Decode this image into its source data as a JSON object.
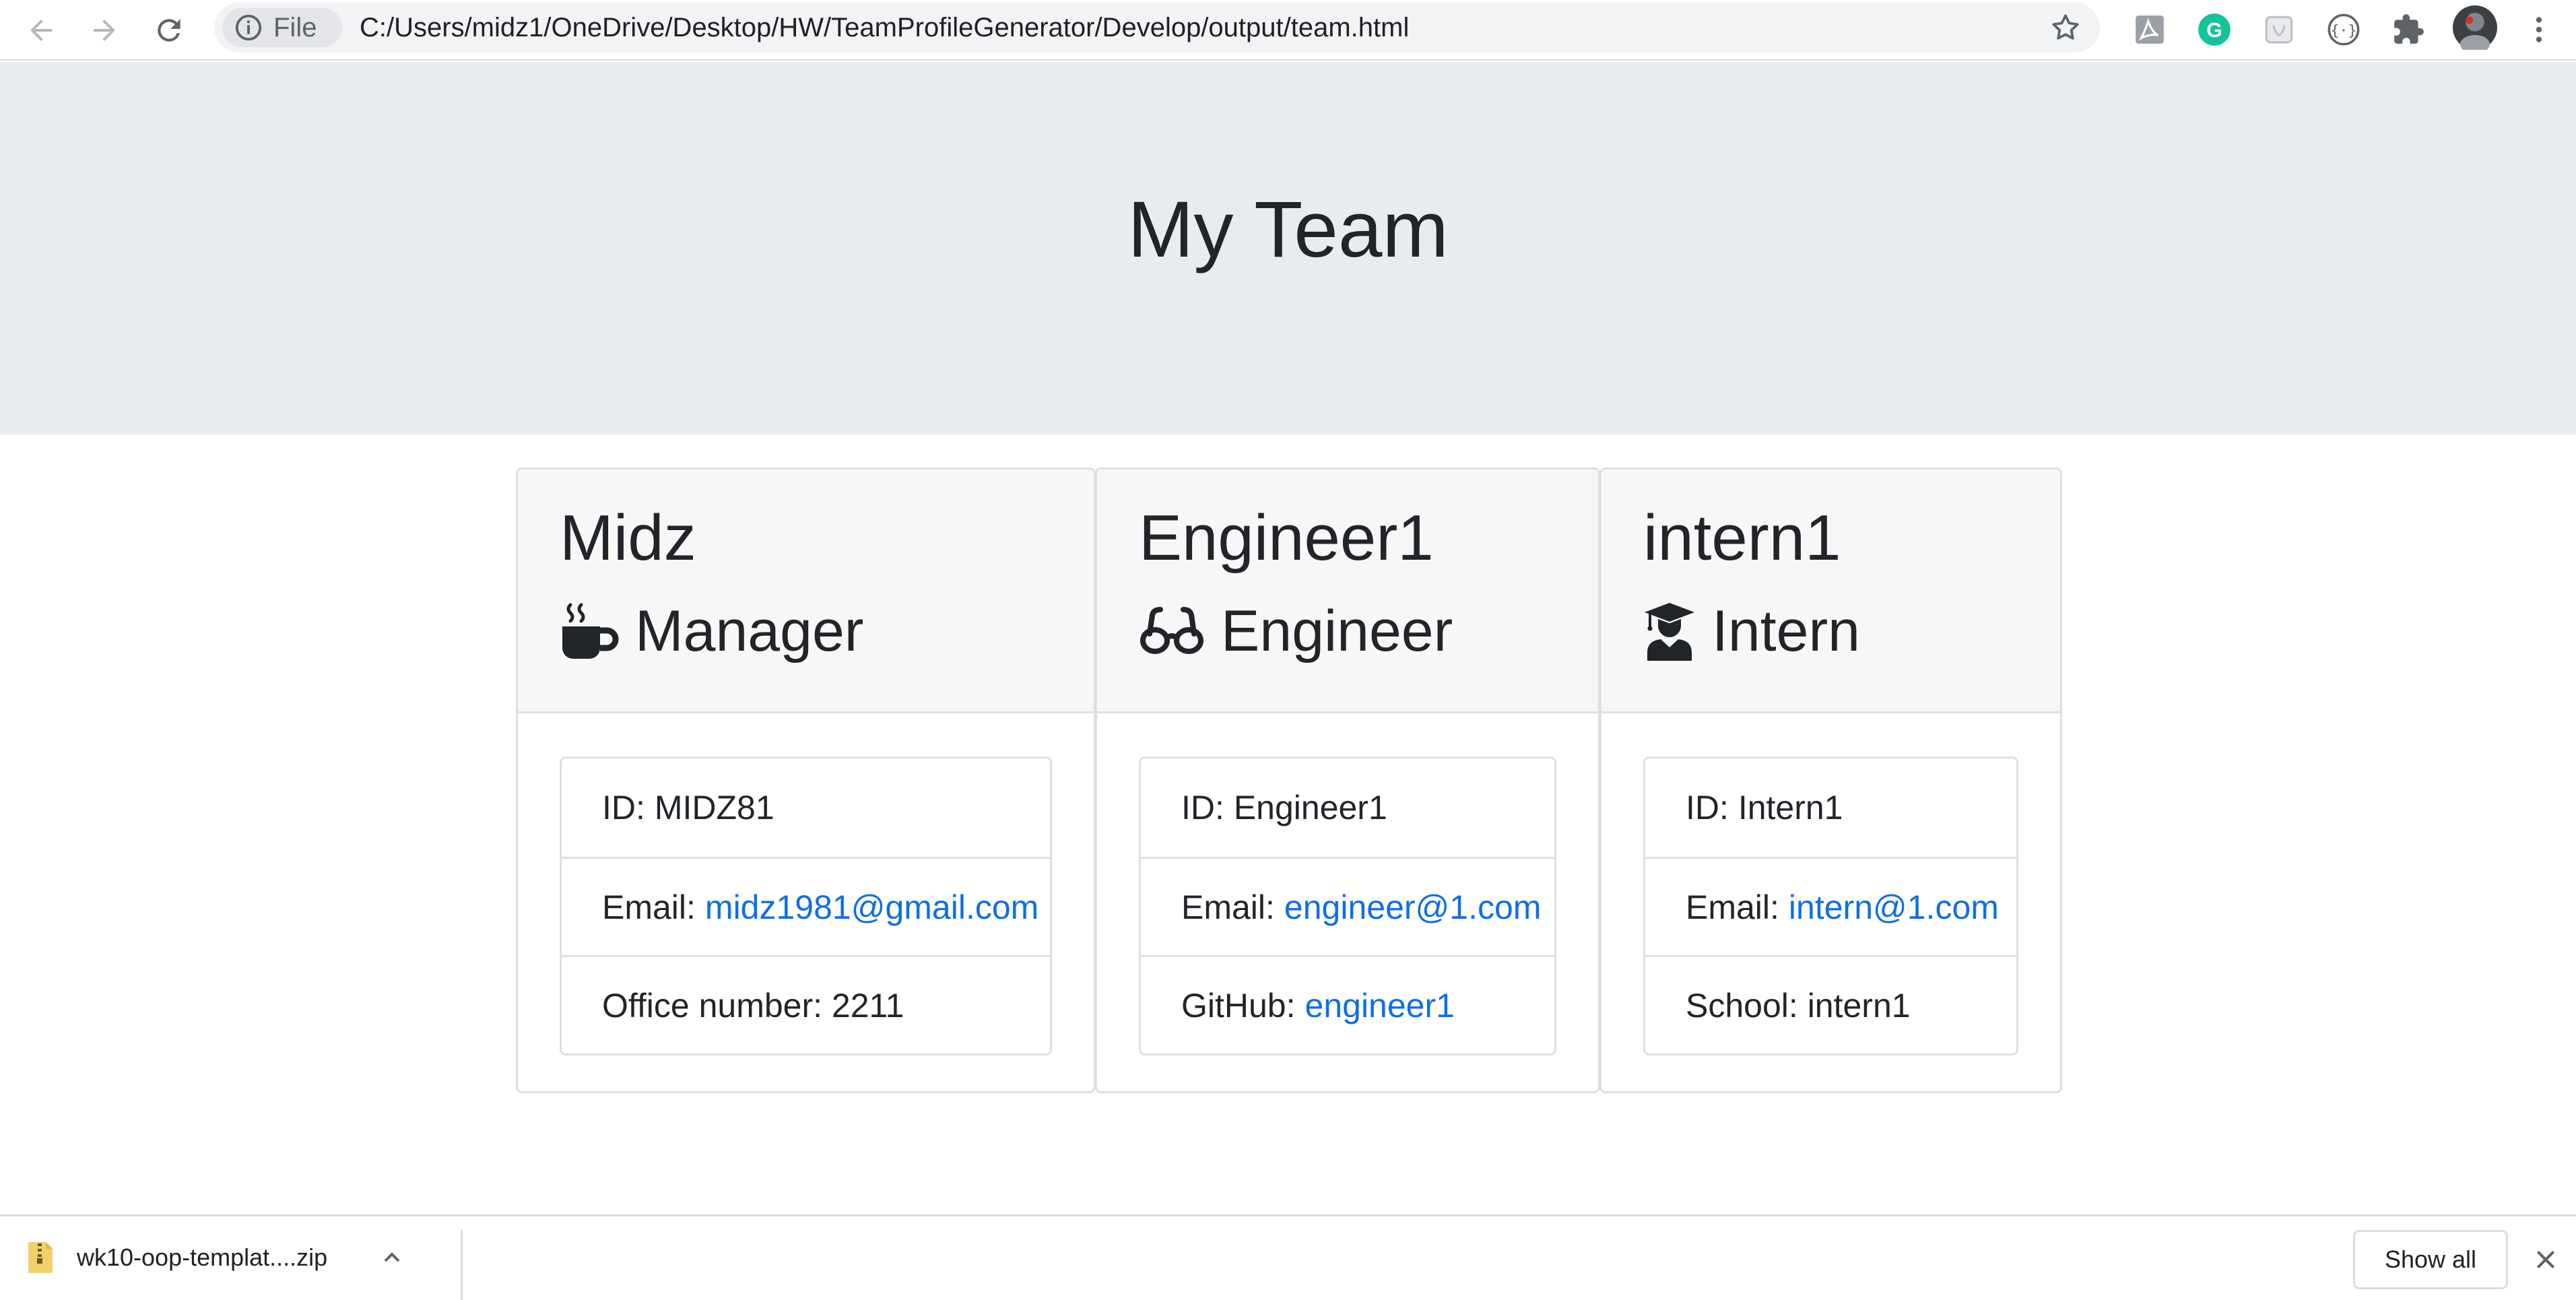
{
  "browser": {
    "chip_label": "File",
    "url": "C:/Users/midz1/OneDrive/Desktop/HW/TeamProfileGenerator/Develop/output/team.html"
  },
  "page": {
    "title": "My Team",
    "cards": [
      {
        "name": "Midz",
        "role": "Manager",
        "role_icon": "mug-hot-icon",
        "id_label": "ID:",
        "id_value": "MIDZ81",
        "email_label": "Email:",
        "email": "midz1981@gmail.com",
        "extra_label": "Office number:",
        "extra_value": "2211"
      },
      {
        "name": "Engineer1",
        "role": "Engineer",
        "role_icon": "glasses-icon",
        "id_label": "ID:",
        "id_value": "Engineer1",
        "email_label": "Email:",
        "email": "engineer@1.com",
        "extra_label": "GitHub:",
        "extra_value": "engineer1"
      },
      {
        "name": "intern1",
        "role": "Intern",
        "role_icon": "graduate-icon",
        "id_label": "ID:",
        "id_value": "Intern1",
        "email_label": "Email:",
        "email": "intern@1.com",
        "extra_label": "School:",
        "extra_value": "intern1"
      }
    ]
  },
  "download_bar": {
    "file_name": "wk10-oop-templat....zip",
    "show_all_label": "Show all"
  },
  "colors": {
    "link": "#0f6ee6",
    "jumbotron_bg": "#e9ecef",
    "card_header_bg": "#f7f7f7",
    "text": "#212529"
  }
}
